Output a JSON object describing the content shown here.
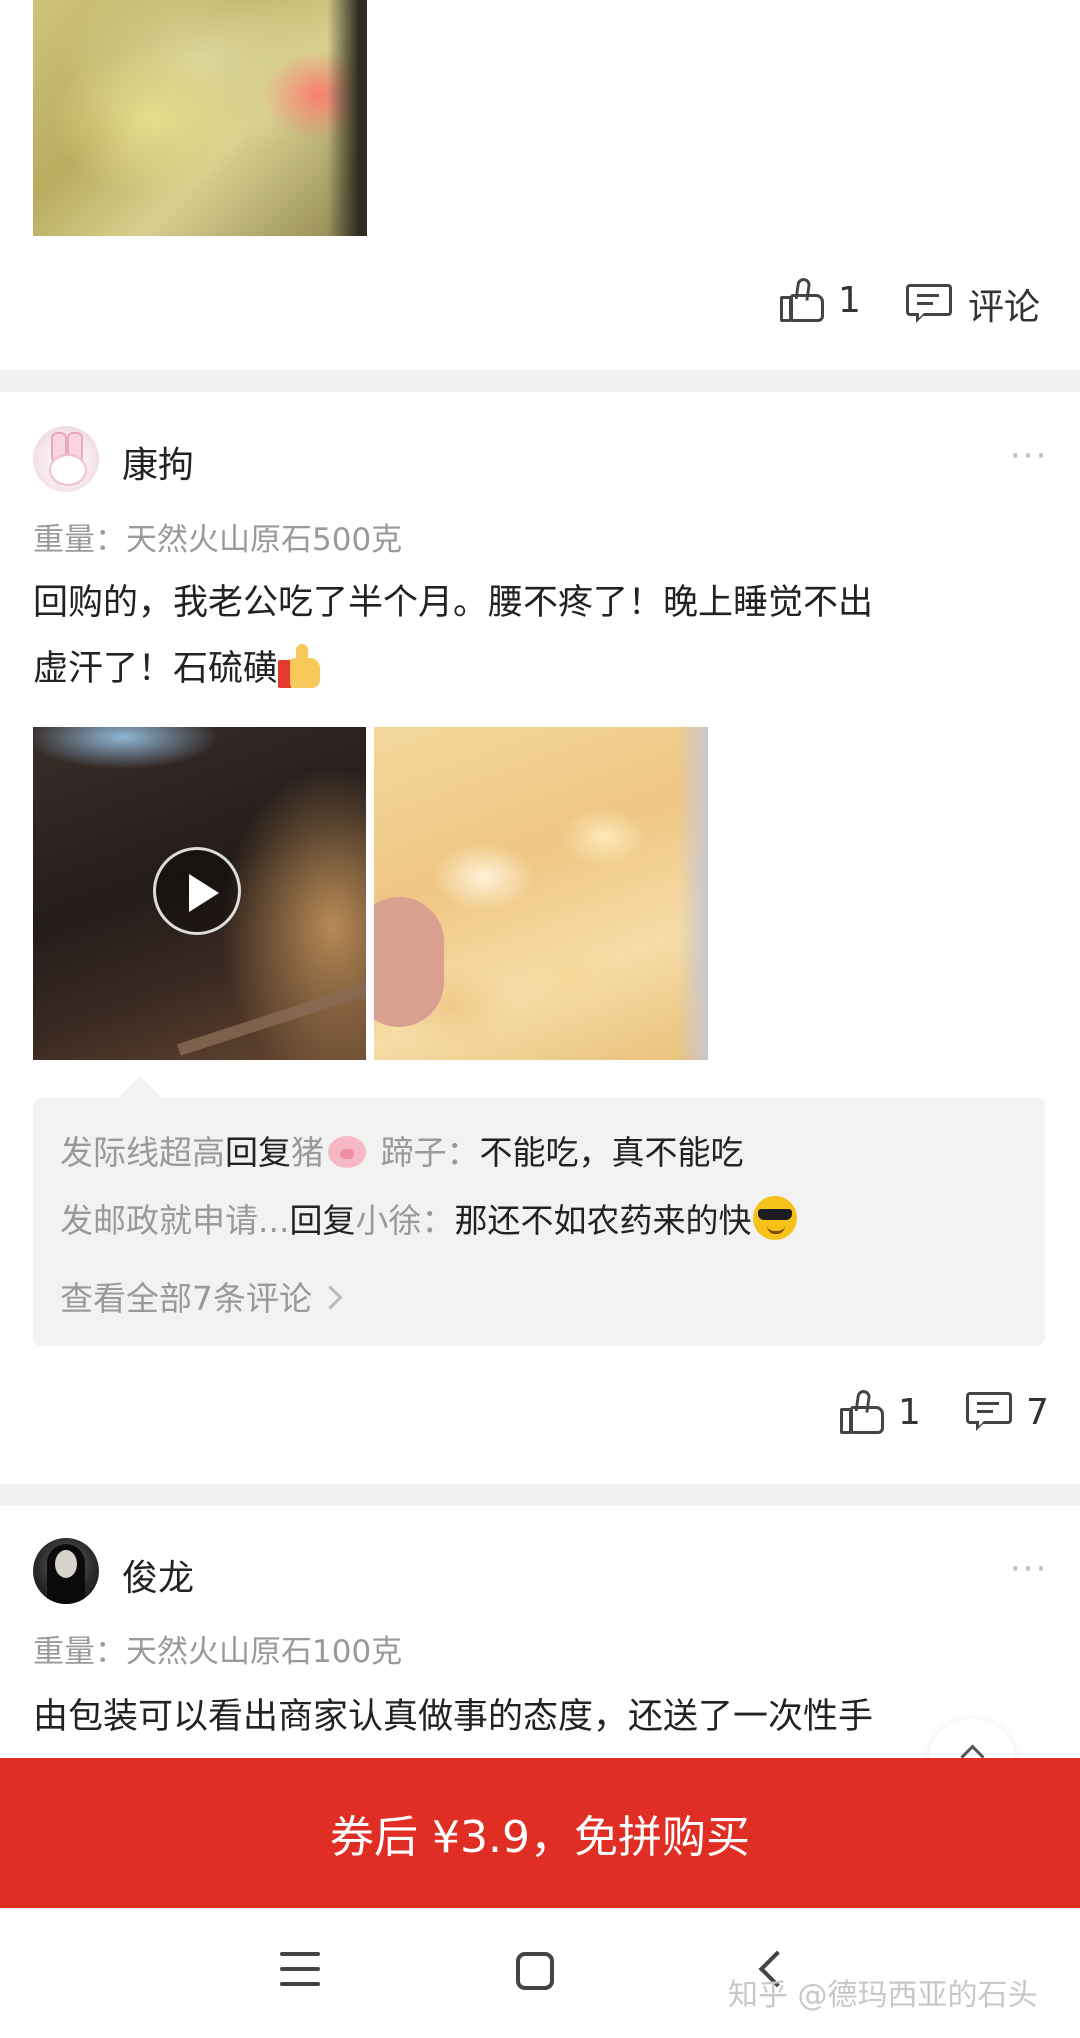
{
  "post_top": {
    "likes": "1",
    "comment_label": "评论"
  },
  "review_1": {
    "username": "康拘",
    "more": "···",
    "spec": "重量：天然火山原石500克",
    "text_line1": "回购的，我老公吃了半个月。腰不疼了！晚上睡觉不出",
    "text_line2": "虚汗了！石硫磺",
    "thumbs_emoji": "thumbs-up-emoji",
    "comments": [
      {
        "user": "发际线超高",
        "action": "回复",
        "target": "猪",
        "target_tail": " 蹄子",
        "text": "不能吃，真不能吃",
        "target_icon": "pig-icon"
      },
      {
        "user": "发邮政就申请...",
        "action": "回复",
        "target": "小徐",
        "text": "那还不如农药来的快",
        "trailing_icon": "sunglasses-emoji"
      }
    ],
    "view_all": "查看全部7条评论",
    "likes": "1",
    "comment_count": "7"
  },
  "review_2": {
    "username": "俊龙",
    "more": "···",
    "spec": "重量：天然火山原石100克",
    "text_line1": "由包装可以看出商家认真做事的态度，还送了一次性手"
  },
  "buy_button": "券后 ¥3.9，免拼购买",
  "watermark": "知乎 @德玛西亚的石头",
  "colors": {
    "accent_red": "#e02e24",
    "separator": "#f1f1f1",
    "comment_box": "#f2f2f2",
    "muted_text": "#999999"
  }
}
